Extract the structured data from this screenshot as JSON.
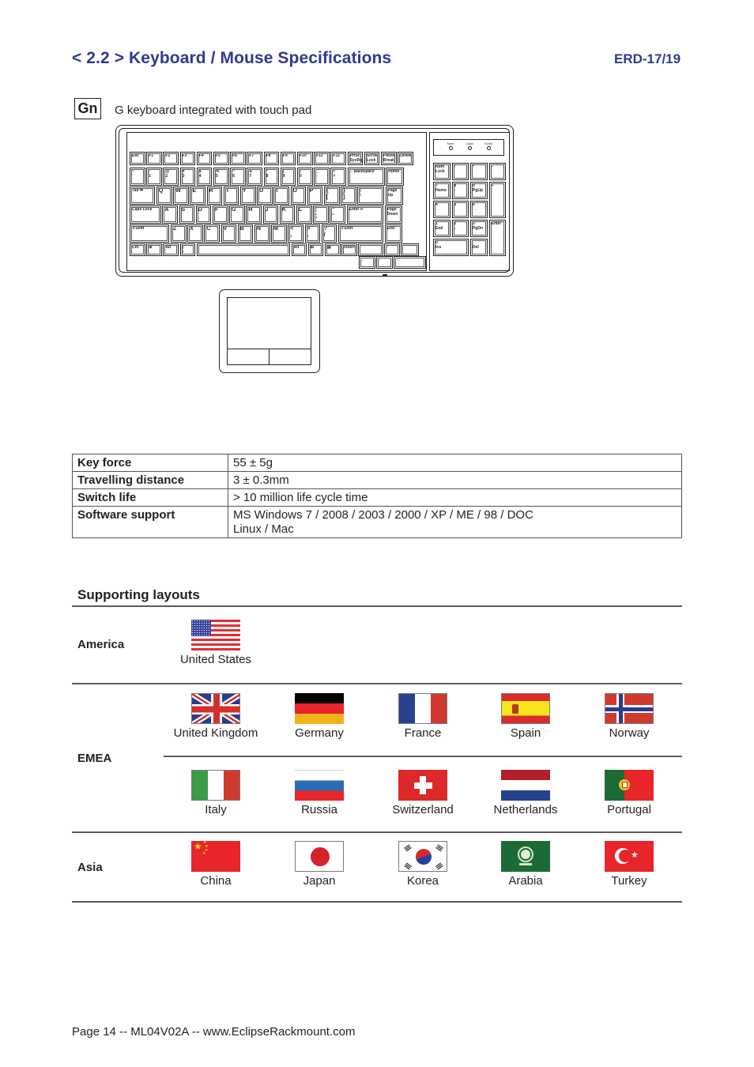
{
  "header": {
    "title": "< 2.2 > Keyboard  /  Mouse Specifications",
    "doc_id": "ERD-17/19",
    "title_color": "#2e3a8c"
  },
  "variant": {
    "code": "Gn",
    "description": "G keyboard integrated with touch pad"
  },
  "keyboard": {
    "leds": [
      "Num",
      "Caps",
      "Scroll"
    ],
    "rows": [
      [
        "Esc",
        "F1",
        "F2",
        "F3",
        "F4",
        "F5",
        "F6",
        "F7",
        "F8",
        "F9",
        "F10",
        "F11",
        "F12",
        "PrtSc\nSysRq",
        "Scroll\nLock",
        "Pause\nBreak",
        "Delete"
      ],
      [
        "~\n`",
        "!\n1",
        "@\n2",
        "#\n3",
        "$\n4",
        "%\n5",
        "^\n6",
        "&\n7",
        "*\n8",
        "(\n9",
        ")\n0",
        "_\n-",
        "+\n=",
        "←Backspace",
        "Home"
      ],
      [
        "Tab ⇆",
        "Q",
        "W",
        "E",
        "R",
        "T",
        "Y",
        "U",
        "I",
        "O",
        "P",
        "{\n[",
        "}\n]",
        "|\n\\",
        "Page\nUp"
      ],
      [
        "Caps Lock",
        "A",
        "S",
        "D",
        "F",
        "G",
        "H",
        "J",
        "K",
        "L",
        ":\n;",
        "\"\n'",
        "Enter ↵",
        "Page\nDown"
      ],
      [
        "⇧Shift",
        "Z",
        "X",
        "C",
        "V",
        "B",
        "N",
        "M",
        "<\n,",
        ">\n.",
        "?\n/",
        "⇧Shift",
        "End"
      ],
      [
        "Ctrl",
        "⊞",
        "Alt",
        "|\n\\",
        "",
        "Alt",
        "⊞",
        "▤",
        "Insert",
        "",
        "↑",
        ""
      ],
      [
        "←",
        "↓",
        "→"
      ]
    ],
    "numpad": [
      [
        "Num\nLock",
        "/",
        "*",
        "−"
      ],
      [
        "7\nHome",
        "8\n↑",
        "9\nPgUp",
        "+"
      ],
      [
        "4\n←",
        "5",
        "6\n→"
      ],
      [
        "1\nEnd",
        "2\n↓",
        "3\nPgDn",
        "Enter"
      ],
      [
        "0\nIns",
        ".\nDel"
      ]
    ]
  },
  "specs": [
    {
      "key": "Key force",
      "value": "55 ± 5g"
    },
    {
      "key": "Travelling distance",
      "value": "3 ± 0.3mm"
    },
    {
      "key": "Switch life",
      "value": "> 10 million life cycle time"
    },
    {
      "key": "Software support",
      "value": "MS Windows 7 / 2008 / 2003 / 2000 / XP / ME / 98 / DOC",
      "value2": "Linux / Mac"
    }
  ],
  "layouts": {
    "title": "Supporting layouts",
    "regions": [
      {
        "name": "America",
        "countries": [
          "United States"
        ]
      },
      {
        "name": "EMEA",
        "countries": [
          "United Kingdom",
          "Germany",
          "France",
          "Spain",
          "Norway",
          "Italy",
          "Russia",
          "Switzerland",
          "Netherlands",
          "Portugal"
        ]
      },
      {
        "name": "Asia",
        "countries": [
          "China",
          "Japan",
          "Korea",
          "Arabia",
          "Turkey"
        ]
      }
    ]
  },
  "footer": {
    "text": "Page 14 -- ML04V02A -- www.EclipseRackmount.com"
  }
}
